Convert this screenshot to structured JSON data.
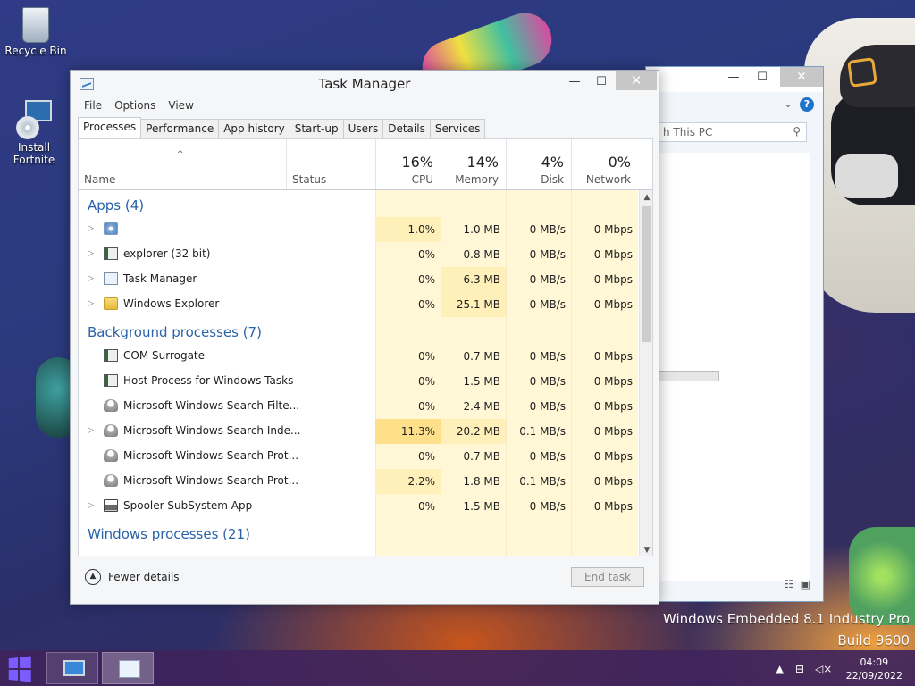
{
  "desktop": {
    "icons": [
      {
        "label": "Recycle Bin"
      },
      {
        "label": "Install Fortnite"
      }
    ],
    "watermark": {
      "line1": "Windows Embedded 8.1 Industry Pro",
      "line2": "Build 9600"
    }
  },
  "explorer": {
    "search_placeholder": "h This PC",
    "help_label": "?"
  },
  "task_manager": {
    "title": "Task Manager",
    "controls": {
      "minimize": "—",
      "maximize": "☐",
      "close": "✕"
    },
    "menu": [
      "File",
      "Options",
      "View"
    ],
    "tabs": [
      "Processes",
      "Performance",
      "App history",
      "Start-up",
      "Users",
      "Details",
      "Services"
    ],
    "active_tab": "Processes",
    "columns": {
      "name": "Name",
      "status": "Status",
      "cpu": {
        "pct": "16%",
        "label": "CPU"
      },
      "memory": {
        "pct": "14%",
        "label": "Memory"
      },
      "disk": {
        "pct": "4%",
        "label": "Disk"
      },
      "network": {
        "pct": "0%",
        "label": "Network"
      }
    },
    "groups": [
      {
        "title": "Apps (4)",
        "rows": [
          {
            "name": "",
            "icon": "gear-icon",
            "expand": true,
            "cpu": "1.0%",
            "mem": "1.0 MB",
            "disk": "0 MB/s",
            "net": "0 Mbps"
          },
          {
            "name": "explorer (32 bit)",
            "icon": "window-icon",
            "expand": true,
            "cpu": "0%",
            "mem": "0.8 MB",
            "disk": "0 MB/s",
            "net": "0 Mbps"
          },
          {
            "name": "Task Manager",
            "icon": "task-manager-icon",
            "expand": true,
            "cpu": "0%",
            "mem": "6.3 MB",
            "disk": "0 MB/s",
            "net": "0 Mbps"
          },
          {
            "name": "Windows Explorer",
            "icon": "folder-icon",
            "expand": true,
            "cpu": "0%",
            "mem": "25.1 MB",
            "disk": "0 MB/s",
            "net": "0 Mbps"
          }
        ]
      },
      {
        "title": "Background processes (7)",
        "rows": [
          {
            "name": "COM Surrogate",
            "icon": "window-icon",
            "expand": false,
            "cpu": "0%",
            "mem": "0.7 MB",
            "disk": "0 MB/s",
            "net": "0 Mbps"
          },
          {
            "name": "Host Process for Windows Tasks",
            "icon": "window-icon",
            "expand": false,
            "cpu": "0%",
            "mem": "1.5 MB",
            "disk": "0 MB/s",
            "net": "0 Mbps"
          },
          {
            "name": "Microsoft Windows Search Filte...",
            "icon": "search-service-icon",
            "expand": false,
            "cpu": "0%",
            "mem": "2.4 MB",
            "disk": "0 MB/s",
            "net": "0 Mbps"
          },
          {
            "name": "Microsoft Windows Search Inde...",
            "icon": "search-service-icon",
            "expand": true,
            "cpu": "11.3%",
            "mem": "20.2 MB",
            "disk": "0.1 MB/s",
            "net": "0 Mbps"
          },
          {
            "name": "Microsoft Windows Search Prot...",
            "icon": "search-service-icon",
            "expand": false,
            "cpu": "0%",
            "mem": "0.7 MB",
            "disk": "0 MB/s",
            "net": "0 Mbps"
          },
          {
            "name": "Microsoft Windows Search Prot...",
            "icon": "search-service-icon",
            "expand": false,
            "cpu": "2.2%",
            "mem": "1.8 MB",
            "disk": "0.1 MB/s",
            "net": "0 Mbps"
          },
          {
            "name": "Spooler SubSystem App",
            "icon": "printer-icon",
            "expand": true,
            "cpu": "0%",
            "mem": "1.5 MB",
            "disk": "0 MB/s",
            "net": "0 Mbps"
          }
        ]
      },
      {
        "title": "Windows processes (21)",
        "rows": []
      }
    ],
    "footer": {
      "fewer_details": "Fewer details",
      "end_task": "End task"
    },
    "colors": {
      "heat_light": "#fff7d6",
      "heat_mid": "#ffefb8",
      "heat_high": "#ffe08a",
      "accent": "#2a63a8"
    }
  },
  "taskbar": {
    "clock_time": "04:09",
    "clock_date": "22/09/2022",
    "tray": [
      "chevron-up-icon",
      "network-icon",
      "volume-muted-icon"
    ]
  }
}
